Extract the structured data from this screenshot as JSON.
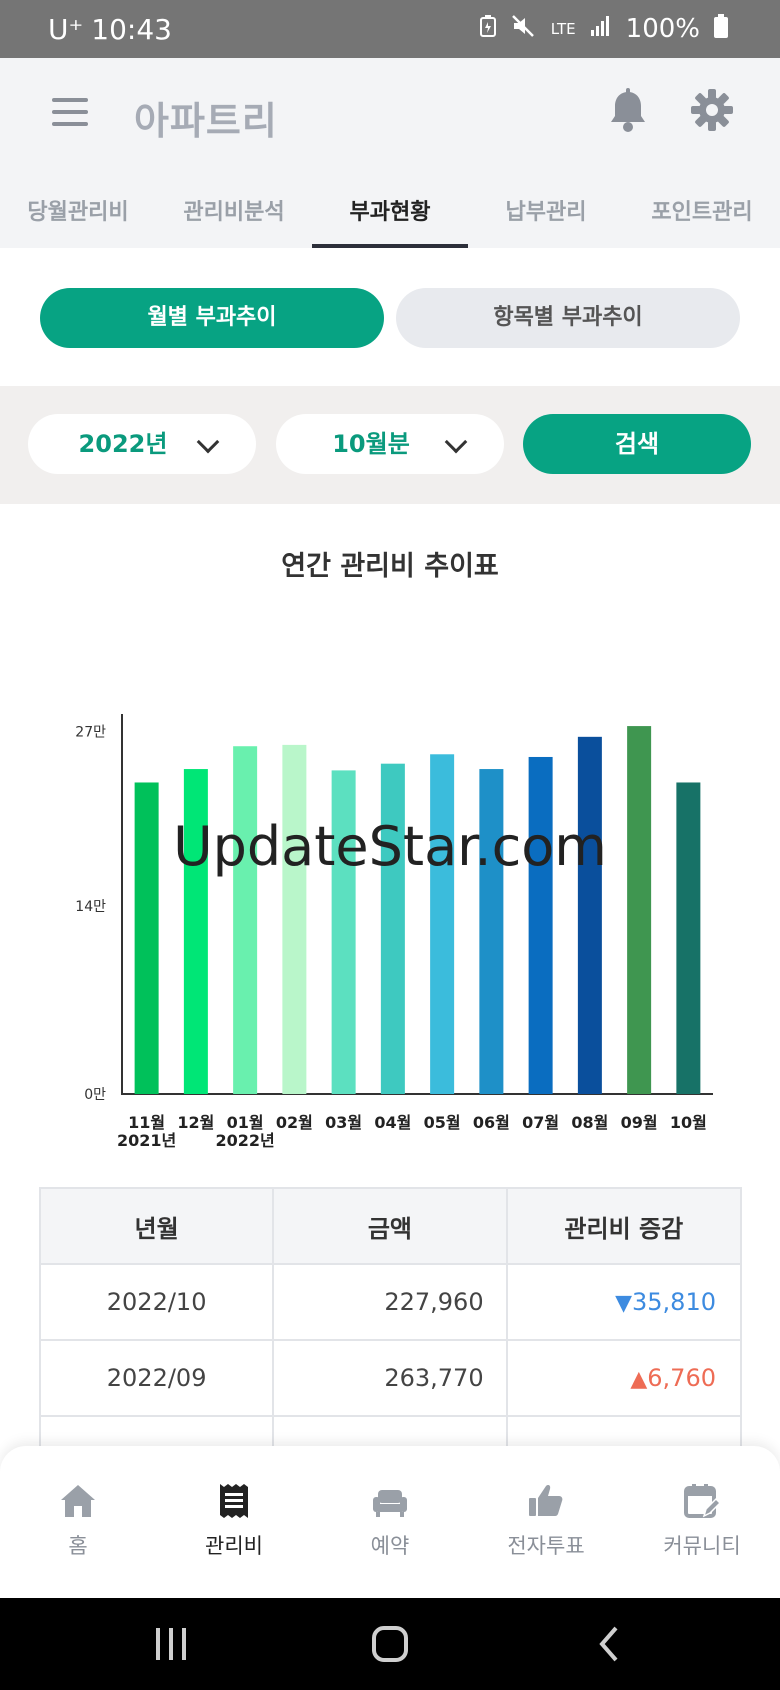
{
  "status_bar": {
    "carrier": "U⁺",
    "time": "10:43",
    "network": "LTE",
    "battery": "100%"
  },
  "header": {
    "logo": "아파트리"
  },
  "tabs": [
    "당월관리비",
    "관리비분석",
    "부과현황",
    "납부관리",
    "포인트관리"
  ],
  "active_tab": "부과현황",
  "segments": {
    "monthly": "월별 부과추이",
    "by_item": "항목별 부과추이"
  },
  "filters": {
    "year": "2022년",
    "month": "10월분",
    "search": "검색"
  },
  "chart_title": "연간 관리비 추이표",
  "watermark": "UpdateStar.com",
  "chart_data": {
    "type": "bar",
    "title": "연간 관리비 추이표",
    "categories": [
      "11월",
      "12월",
      "01월",
      "02월",
      "03월",
      "04월",
      "05월",
      "06월",
      "07월",
      "08월",
      "09월",
      "10월"
    ],
    "year_labels": [
      "2021년",
      "",
      "2022년",
      "",
      "",
      "",
      "",
      "",
      "",
      "",
      "",
      ""
    ],
    "values": [
      232000,
      242000,
      259000,
      260000,
      241000,
      246000,
      253000,
      242000,
      251000,
      266000,
      274000,
      232000
    ],
    "yticks": [
      "0만",
      "14만",
      "27만"
    ],
    "ytick_values": [
      0,
      140000,
      270000
    ],
    "ylim": [
      0,
      283000
    ],
    "colors": [
      "#00c15a",
      "#00e676",
      "#69f0ae",
      "#b9f6ca",
      "#5ce0c0",
      "#3ec9c0",
      "#3bbcdc",
      "#1e90c8",
      "#0a6dc0",
      "#0a4f9c",
      "#3f9650",
      "#177267"
    ]
  },
  "table": {
    "headers": [
      "년월",
      "금액",
      "관리비 증감"
    ],
    "rows": [
      {
        "ym": "2022/10",
        "amount": "227,960",
        "dir": "down",
        "arrow": "▼",
        "delta": "35,810"
      },
      {
        "ym": "2022/09",
        "amount": "263,770",
        "dir": "up",
        "arrow": "▲",
        "delta": "6,760"
      }
    ]
  },
  "bottom_nav": [
    "홈",
    "관리비",
    "예약",
    "전자투표",
    "커뮤니티"
  ],
  "colors": {
    "accent": "#07a383",
    "down": "#3d8be0",
    "up": "#ee6c55"
  }
}
